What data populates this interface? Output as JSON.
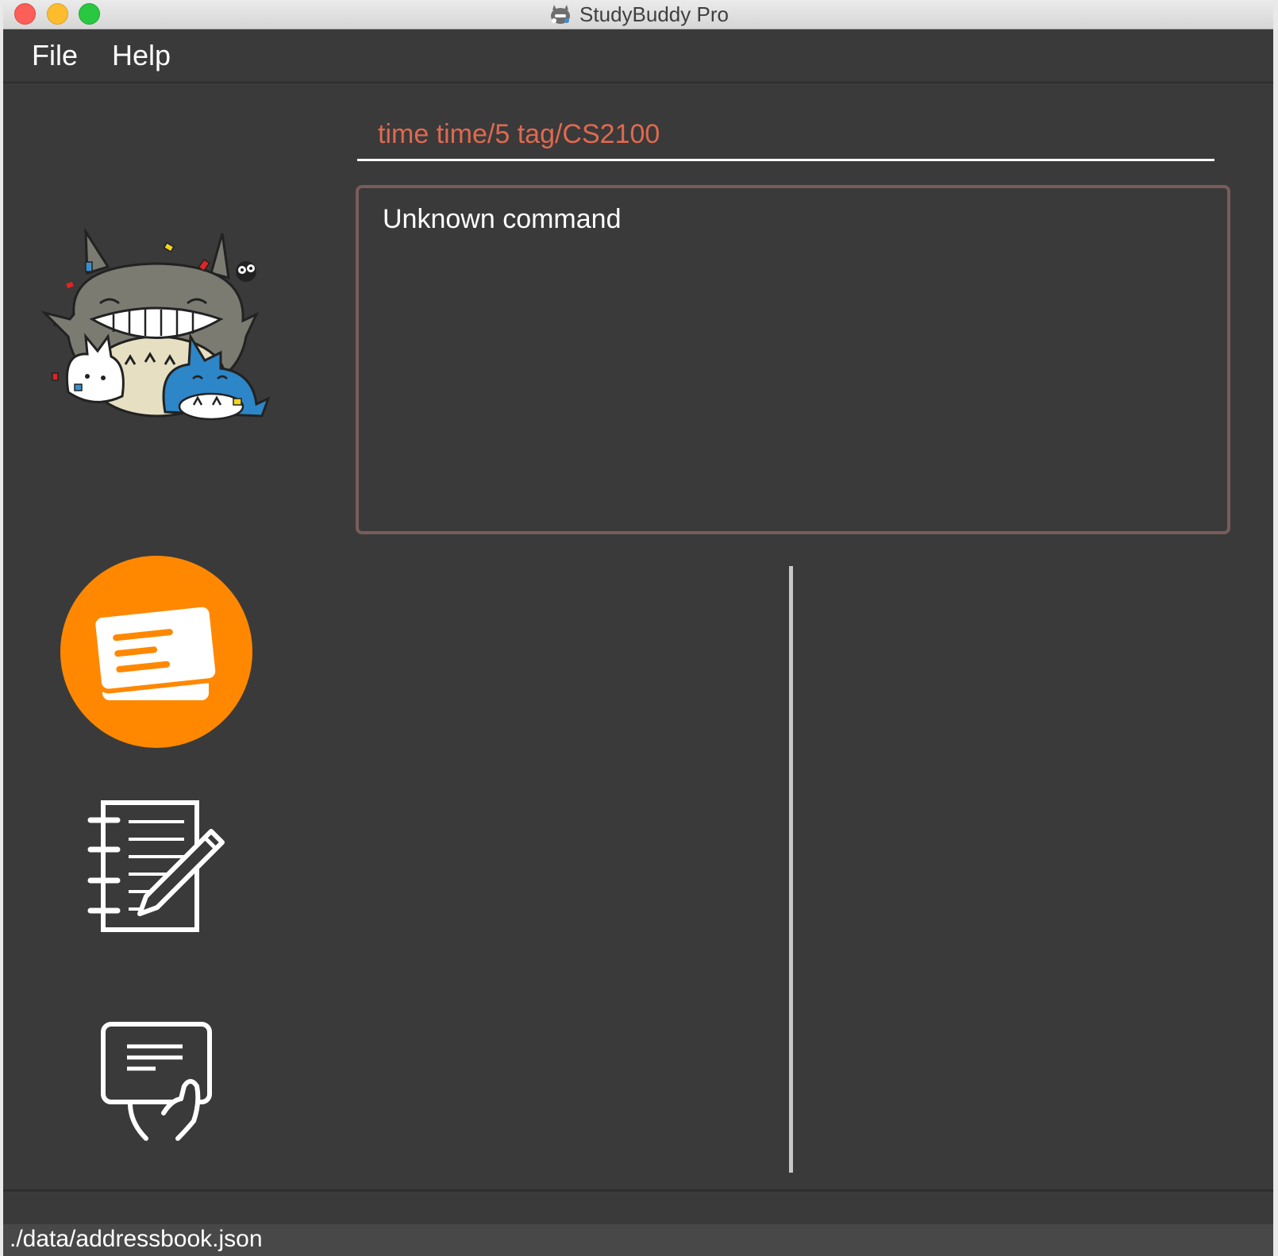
{
  "window": {
    "title": "StudyBuddy Pro"
  },
  "menu": {
    "file_label": "File",
    "help_label": "Help"
  },
  "command": {
    "value": "time time/5 tag/CS2100"
  },
  "result": {
    "message": "Unknown command"
  },
  "status": {
    "file_path": "./data/addressbook.json"
  },
  "colors": {
    "command_text": "#e0694f",
    "accent": "#ff8800",
    "background": "#3a3a3a",
    "result_border": "#7a5b5b"
  },
  "icons": {
    "mascot": "totoro-mascot-icon",
    "flashcard": "flashcard-icon",
    "notes": "notebook-pen-icon",
    "quiz": "quiz-hand-icon"
  }
}
